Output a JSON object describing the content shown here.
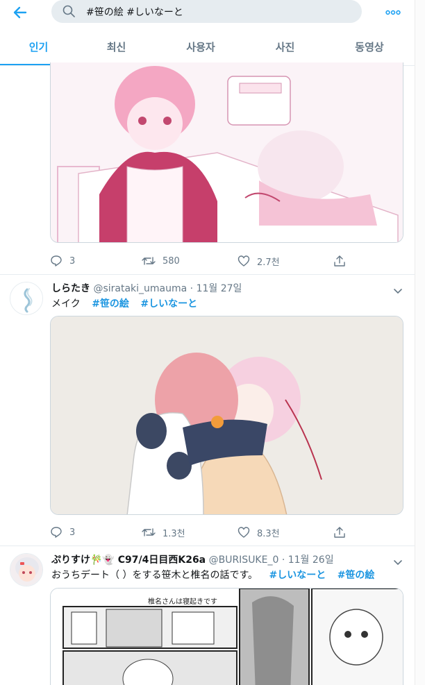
{
  "search": {
    "query": "#笹の絵 #しいなーと"
  },
  "tabs": [
    {
      "label": "인기"
    },
    {
      "label": "최신"
    },
    {
      "label": "사용자"
    },
    {
      "label": "사진"
    },
    {
      "label": "동영상"
    }
  ],
  "tweets": [
    {
      "actions": {
        "replies": "3",
        "retweets": "580",
        "likes": "2.7천"
      }
    },
    {
      "name": "しらたき",
      "handle": "@sirataki_umauma",
      "time": "· 11월 27일",
      "text": "メイク",
      "hashtags": [
        "#笹の絵",
        "#しいなーと"
      ],
      "actions": {
        "replies": "3",
        "retweets": "1.3천",
        "likes": "8.3천"
      }
    },
    {
      "name": "ぷりすけ🎋👻 C97/4日目西K26a",
      "handle": "@BURISUKE_0",
      "time": "· 11월 26일",
      "text": "おうちデート（ ）をする笹木と椎名の話です。",
      "hashtags": [
        "#しいなーと",
        "#笹の絵"
      ],
      "manga_title": "椎名さんは寝起きです"
    }
  ],
  "colors": {
    "accent": "#1da1f2",
    "hashtag": "#1b95e0",
    "muted": "#657786",
    "border": "#e6ecf0"
  }
}
